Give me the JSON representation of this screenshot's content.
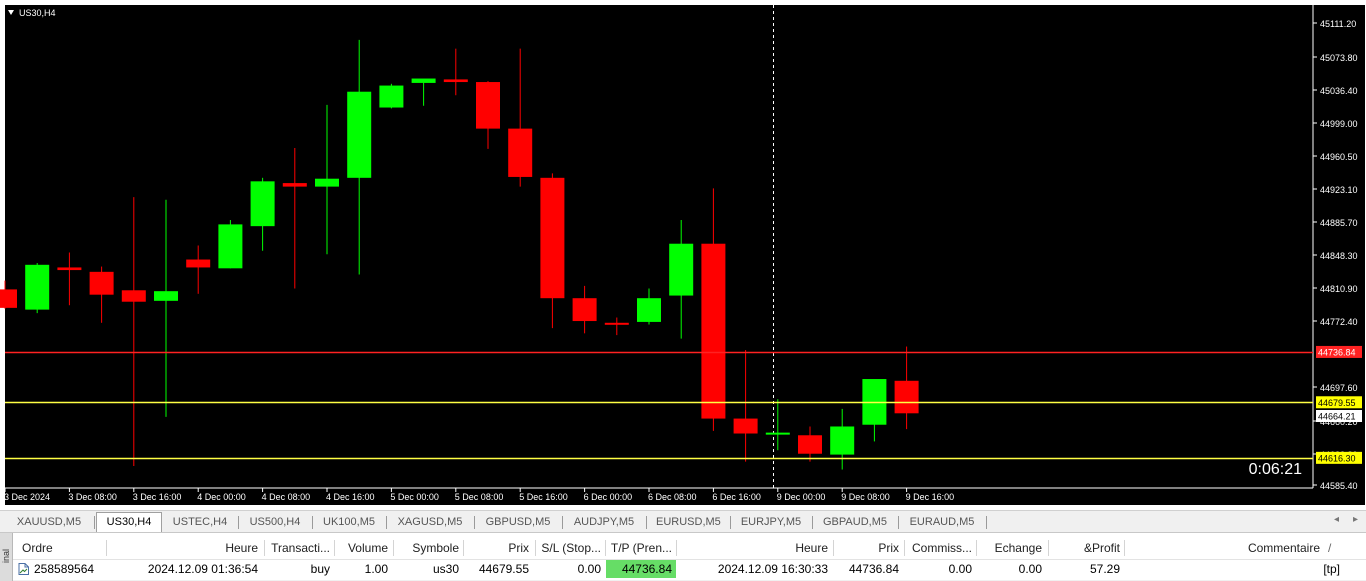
{
  "chart": {
    "symbol_label": "US30,H4",
    "timer": "0:06:21",
    "colors": {
      "background": "#000000",
      "bull": "#00ff00",
      "bear": "#ff0000",
      "text": "#ffffff",
      "grid": "#ffffff"
    },
    "price_axis": {
      "min": 44585.4,
      "max": 45111.2,
      "ticks": [
        "45111.20",
        "45073.80",
        "45036.40",
        "44999.00",
        "44960.50",
        "44923.10",
        "44885.70",
        "44848.30",
        "44810.90",
        "44772.40",
        "44697.60",
        "44660.20",
        "44622.80",
        "44585.40"
      ]
    },
    "time_axis": {
      "labels": [
        "3 Dec 2024",
        "3 Dec 08:00",
        "3 Dec 16:00",
        "4 Dec 00:00",
        "4 Dec 08:00",
        "4 Dec 16:00",
        "5 Dec 00:00",
        "5 Dec 08:00",
        "5 Dec 16:00",
        "6 Dec 00:00",
        "6 Dec 08:00",
        "6 Dec 16:00",
        "9 Dec 00:00",
        "9 Dec 08:00",
        "9 Dec 16:00"
      ]
    },
    "levels": [
      {
        "price": 44736.84,
        "label": "44736.84",
        "line_color": "#ff2222",
        "label_bg": "#ff2222",
        "label_color": "#ffffff"
      },
      {
        "price": 44679.55,
        "label": "44679.55",
        "line_color": "#ffff44",
        "label_bg": "#ffff00",
        "label_color": "#000000"
      },
      {
        "price": 44664.21,
        "label": "44664.21",
        "line_color": null,
        "label_bg": "#ffffff",
        "label_color": "#000000"
      },
      {
        "price": 44616.3,
        "label": "44616.30",
        "line_color": "#ffff44",
        "label_bg": "#ffff00",
        "label_color": "#000000"
      }
    ],
    "candles": [
      {
        "o": 44808,
        "h": 44818,
        "l": 44786,
        "c": 44787
      },
      {
        "o": 44785,
        "h": 44838,
        "l": 44781,
        "c": 44836
      },
      {
        "o": 44833,
        "h": 44850,
        "l": 44790,
        "c": 44830
      },
      {
        "o": 44828,
        "h": 44834,
        "l": 44770,
        "c": 44802
      },
      {
        "o": 44807,
        "h": 44913,
        "l": 44607,
        "c": 44794
      },
      {
        "o": 44795,
        "h": 44910,
        "l": 44663,
        "c": 44806
      },
      {
        "o": 44842,
        "h": 44858,
        "l": 44803,
        "c": 44833
      },
      {
        "o": 44832,
        "h": 44887,
        "l": 44832,
        "c": 44882
      },
      {
        "o": 44880,
        "h": 44935,
        "l": 44852,
        "c": 44931
      },
      {
        "o": 44929,
        "h": 44969,
        "l": 44809,
        "c": 44925
      },
      {
        "o": 44925,
        "h": 45018,
        "l": 44848,
        "c": 44934
      },
      {
        "o": 44935,
        "h": 45092,
        "l": 44825,
        "c": 45033
      },
      {
        "o": 45015,
        "h": 45042,
        "l": 45014,
        "c": 45040
      },
      {
        "o": 45043,
        "h": 45047,
        "l": 45017,
        "c": 45048
      },
      {
        "o": 45047,
        "h": 45082,
        "l": 45029,
        "c": 45044
      },
      {
        "o": 45044,
        "h": 45045,
        "l": 44968,
        "c": 44991
      },
      {
        "o": 44991,
        "h": 45082,
        "l": 44925,
        "c": 44936
      },
      {
        "o": 44935,
        "h": 44940,
        "l": 44764,
        "c": 44798
      },
      {
        "o": 44798,
        "h": 44812,
        "l": 44758,
        "c": 44772
      },
      {
        "o": 44770,
        "h": 44776,
        "l": 44756,
        "c": 44769
      },
      {
        "o": 44771,
        "h": 44809,
        "l": 44768,
        "c": 44798
      },
      {
        "o": 44801,
        "h": 44887,
        "l": 44752,
        "c": 44860
      },
      {
        "o": 44860,
        "h": 44923,
        "l": 44647,
        "c": 44661
      },
      {
        "o": 44661,
        "h": 44739,
        "l": 44612,
        "c": 44644
      },
      {
        "o": 44644,
        "h": 44683,
        "l": 44625,
        "c": 44645
      },
      {
        "o": 44642,
        "h": 44652,
        "l": 44612,
        "c": 44621
      },
      {
        "o": 44620,
        "h": 44672,
        "l": 44603,
        "c": 44652
      },
      {
        "o": 44654,
        "h": 44704,
        "l": 44635,
        "c": 44706
      },
      {
        "o": 44704,
        "h": 44743,
        "l": 44649,
        "c": 44667
      }
    ]
  },
  "tabs": [
    "XAUUSD,M5",
    "US30,H4",
    "USTEC,H4",
    "US500,H4",
    "UK100,M5",
    "XAGUSD,M5",
    "GBPUSD,M5",
    "AUDJPY,M5",
    "EURUSD,M5",
    "EURJPY,M5",
    "GBPAUD,M5",
    "EURAUD,M5"
  ],
  "tab_scroll": {
    "left": "◂",
    "right": "▸"
  },
  "terminal": {
    "side_label": "inal",
    "headers": {
      "order": "Ordre",
      "time": "Heure",
      "type": "Transacti...",
      "volume": "Volume",
      "symbol": "Symbole",
      "price": "Prix",
      "sl": "S/L (Stop...",
      "tp": "T/P (Pren...",
      "time2": "Heure",
      "price2": "Prix",
      "commission": "Commiss...",
      "swap": "Echange",
      "profit": "&Profit",
      "comment": "Commentaire",
      "close": "/"
    },
    "row": {
      "order": "258589564",
      "time": "2024.12.09 01:36:54",
      "type": "buy",
      "volume": "1.00",
      "symbol": "us30",
      "price": "44679.55",
      "sl": "0.00",
      "tp": "44736.84",
      "time2": "2024.12.09 16:30:33",
      "price2": "44736.84",
      "commission": "0.00",
      "swap": "0.00",
      "profit": "57.29",
      "comment": "[tp]"
    }
  }
}
